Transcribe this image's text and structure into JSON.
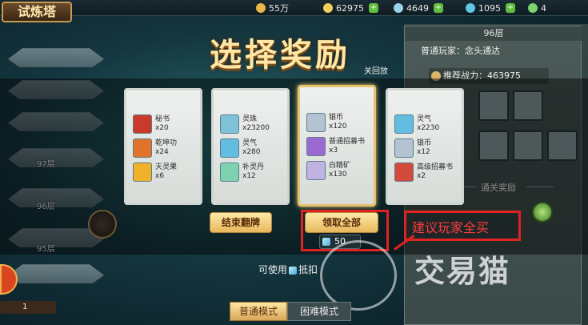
{
  "top_bar": {
    "tower_name": "试炼塔",
    "resources": [
      {
        "icon": "coin-icon",
        "value": "55万"
      },
      {
        "icon": "gold-ingot-icon",
        "value": "62975"
      },
      {
        "icon": "diamond-icon",
        "value": "4649"
      },
      {
        "icon": "gem-icon",
        "value": "1095"
      },
      {
        "icon": "spirit-orb-icon",
        "value": "4"
      }
    ]
  },
  "tower": {
    "floors": [
      "97层",
      "96层",
      "95层"
    ]
  },
  "right_panel": {
    "floor": "96层",
    "player_label": "普通玩家：念头通达",
    "recommended_power_label": "推荐战力：",
    "recommended_power_value": "463975",
    "pass_reward_title": "通关奖励"
  },
  "modal": {
    "title": "选择奖励",
    "pass_replay_label": "关回放",
    "cards": [
      {
        "selected": false,
        "items": [
          {
            "name": "秘书",
            "qty": "x20",
            "color": "#c93a2a"
          },
          {
            "name": "乾坤功",
            "qty": "x24",
            "color": "#e0742a"
          },
          {
            "name": "天灵果",
            "qty": "x6",
            "color": "#f0b22a"
          }
        ]
      },
      {
        "selected": false,
        "items": [
          {
            "name": "灵珠",
            "qty": "x23200",
            "color": "#7fc2d8"
          },
          {
            "name": "灵气",
            "qty": "x280",
            "color": "#62bde0"
          },
          {
            "name": "补灵丹",
            "qty": "x12",
            "color": "#7fd2b0"
          }
        ]
      },
      {
        "selected": true,
        "items": [
          {
            "name": "银币",
            "qty": "x120",
            "color": "#b4c3d2"
          },
          {
            "name": "普通招募书",
            "qty": "x3",
            "color": "#9a6ad2"
          },
          {
            "name": "白精矿",
            "qty": "x130",
            "color": "#c0b3e2"
          }
        ]
      },
      {
        "selected": false,
        "items": [
          {
            "name": "灵气",
            "qty": "x2230",
            "color": "#62bde0"
          },
          {
            "name": "银币",
            "qty": "x12",
            "color": "#b4c3d2"
          },
          {
            "name": "高级招募书",
            "qty": "x2",
            "color": "#d24a3a"
          }
        ]
      }
    ],
    "end_flip_button": "结束翻牌",
    "claim_all_button": "领取全部",
    "claim_cost": "50",
    "use_text_before": "可使用",
    "use_text_after": "抵扣",
    "tip_annotation": "建议玩家全买"
  },
  "tabs": {
    "normal": "普通模式",
    "hard": "困难模式"
  },
  "misc": {
    "bottom_badge": "1",
    "watermark": "交易猫"
  },
  "colors": {
    "annotation_red": "#e02222",
    "gold_title": "#ffe7a6"
  }
}
